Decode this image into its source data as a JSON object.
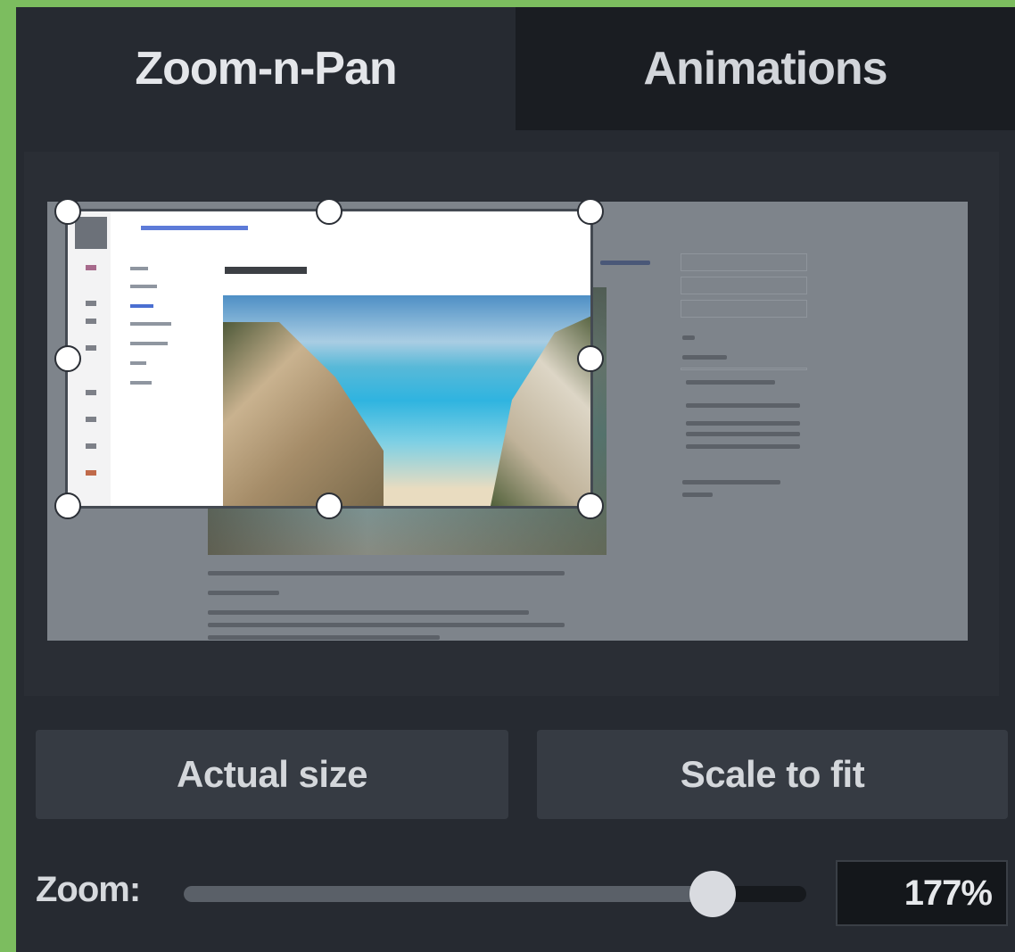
{
  "tabs": [
    {
      "label": "Zoom-n-Pan",
      "active": true
    },
    {
      "label": "Animations",
      "active": false
    }
  ],
  "buttons": {
    "actual_size": "Actual size",
    "scale_to_fit": "Scale to fit"
  },
  "zoom": {
    "label": "Zoom:",
    "value_text": "177%",
    "slider_fraction": 0.85
  },
  "colors": {
    "panel_bg": "#262a31",
    "inactive_tab_bg": "#1a1d22",
    "button_bg": "#363b43",
    "outer_border": "#7cbd5f"
  }
}
